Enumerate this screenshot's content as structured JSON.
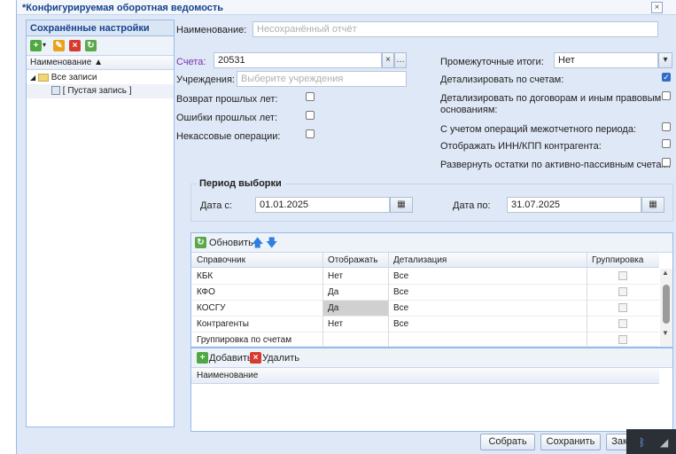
{
  "window": {
    "title": "*Конфигурируемая оборотная ведомость",
    "close_glyph": "×"
  },
  "left_panel": {
    "title": "Сохранённые настройки",
    "column_header": "Наименование ▲",
    "tree": [
      {
        "label": "Все записи"
      },
      {
        "label": "[ Пустая запись ]"
      }
    ]
  },
  "form": {
    "name_label": "Наименование:",
    "name_placeholder": "Несохранённый отчёт",
    "accounts_label": "Счета:",
    "accounts_value": "20531",
    "institutions_label": "Учреждения:",
    "institutions_placeholder": "Выберите учреждения",
    "left_checks": [
      {
        "label": "Возврат прошлых лет:",
        "checked": false
      },
      {
        "label": "Ошибки прошлых лет:",
        "checked": false
      },
      {
        "label": "Некассовые операции:",
        "checked": false
      }
    ],
    "subtotals_label": "Промежуточные итоги:",
    "subtotals_value": "Нет",
    "right_checks": [
      {
        "label": "Детализировать по счетам:",
        "checked": true
      },
      {
        "label": "Детализировать по договорам и иным правовым",
        "label2": "основаниям:",
        "checked": false
      },
      {
        "label": "С учетом операций межотчетного периода:",
        "checked": false
      },
      {
        "label": "Отображать ИНН/КПП контрагента:",
        "checked": false
      },
      {
        "label": "Развернуть остатки по активно-пассивным счетам:",
        "checked": false
      }
    ],
    "period": {
      "legend": "Период выборки",
      "from_label": "Дата с:",
      "from_value": "01.01.2025",
      "to_label": "Дата по:",
      "to_value": "31.07.2025"
    }
  },
  "ref_grid": {
    "refresh_label": "Обновить",
    "headers": [
      "Справочник",
      "Отображать",
      "Детализация",
      "Группировка"
    ],
    "rows": [
      {
        "name": "КБК",
        "show": "Нет",
        "detail": "Все"
      },
      {
        "name": "КФО",
        "show": "Да",
        "detail": "Все"
      },
      {
        "name": "КОСГУ",
        "show": "Да",
        "detail": "Все"
      },
      {
        "name": "Контрагенты",
        "show": "Нет",
        "detail": "Все"
      },
      {
        "name": "Группировка по счетам",
        "show": "",
        "detail": ""
      }
    ]
  },
  "bottom_grid": {
    "add_label": "Добавить",
    "delete_label": "Удалить",
    "header": "Наименование"
  },
  "footer": {
    "collect_label": "Собрать",
    "save_label": "Сохранить",
    "close_label": "Зак"
  },
  "colors": {
    "accent": "#15428b",
    "panel_bg": "#dfe8f6",
    "border": "#99bbe8",
    "checked": "#2f6dc8"
  }
}
